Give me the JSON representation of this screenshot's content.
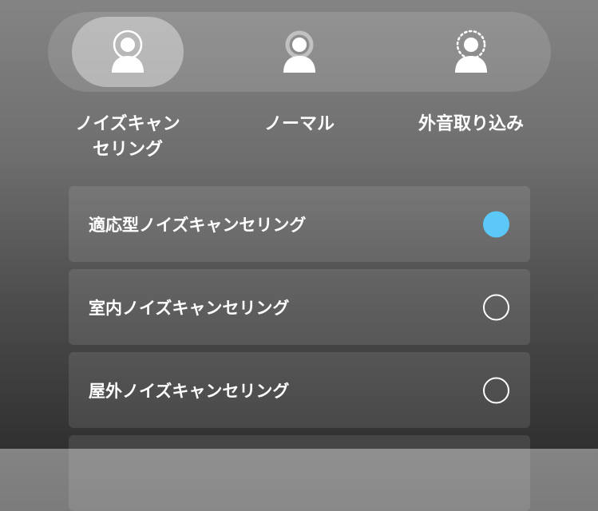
{
  "modes": [
    {
      "label_line1": "ノイズキャン",
      "label_line2": "セリング",
      "icon": "noise-cancelling-icon",
      "selected": true
    },
    {
      "label_line1": "ノーマル",
      "icon": "normal-mode-icon",
      "selected": false
    },
    {
      "label_line1": "外音取り込み",
      "icon": "ambient-sound-icon",
      "selected": false
    }
  ],
  "options": [
    {
      "label": "適応型ノイズキャンセリング",
      "selected": true
    },
    {
      "label": "室内ノイズキャンセリング",
      "selected": false
    },
    {
      "label": "屋外ノイズキャンセリング",
      "selected": false
    }
  ],
  "colors": {
    "accent": "#5cc8f8"
  }
}
